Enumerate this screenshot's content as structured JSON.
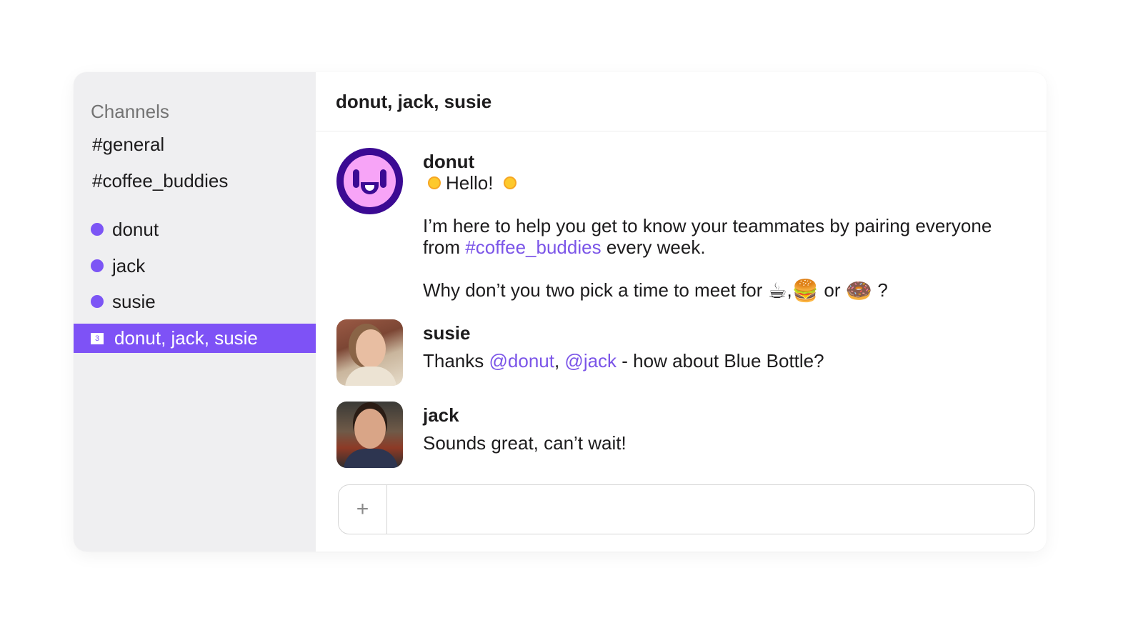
{
  "sidebar": {
    "section_label": "Channels",
    "channels": [
      "#general",
      "#coffee_buddies"
    ],
    "direct_messages": [
      "donut",
      "jack",
      "susie"
    ],
    "group_dm": {
      "badge": "3",
      "label": "donut, jack, susie",
      "selected": true
    }
  },
  "colors": {
    "accent": "#7e52f6",
    "mention": "#7b55e8",
    "presence": "#7c55f5",
    "sidebar_bg": "#efeff1"
  },
  "header": {
    "title": "donut, jack, susie"
  },
  "messages": [
    {
      "author": "donut",
      "avatar": "donut-bot-smiley",
      "greeting": "Hello!",
      "line1_a": "I’m here to help you get to know your teammates by pairing everyone",
      "line1_b": "from ",
      "channel_link": "#coffee_buddies",
      "line1_c": " every week.",
      "line2_a": "Why don’t you two pick a time to meet for ",
      "emoji_coffee": "☕",
      "sep1": ",",
      "emoji_burger": "🍔",
      "sep2": "or",
      "emoji_donut": "🍩",
      "end": " ?"
    },
    {
      "author": "susie",
      "avatar": "susie-photo",
      "text_a": "Thanks ",
      "mention1": "@donut",
      "text_b": ", ",
      "mention2": "@jack",
      "text_c": " - how about Blue Bottle?"
    },
    {
      "author": "jack",
      "avatar": "jack-photo",
      "text": "Sounds great, can’t wait!"
    }
  ],
  "composer": {
    "add_label": "+",
    "value": "",
    "placeholder": ""
  }
}
